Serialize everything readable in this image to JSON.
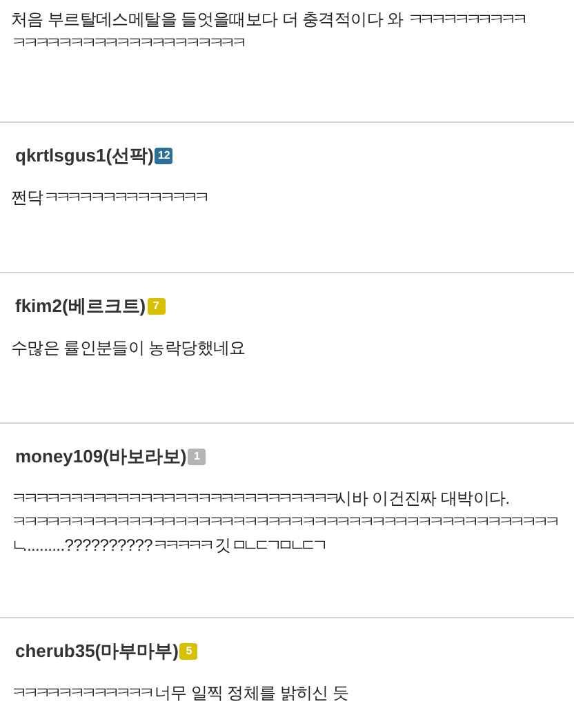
{
  "comments": [
    {
      "body_lines": [
        "처음 부르탈데스메탈을 들엇을때보다 더 충격적이다 와 ㅋㅋㅋㅋㅋㅋㅋㅋㅋㅋ",
        "ㅋㅋㅋㅋㅋㅋㅋㅋㅋㅋㅋㅋㅋㅋㅋㅋㅋㅋㅋㅋ"
      ]
    },
    {
      "author": "qkrtlsgus1(선팍)",
      "level_badge": {
        "text": "12",
        "color": "#2b7099"
      },
      "body_lines": [
        "쩐닥ㅋㅋㅋㅋㅋㅋㅋㅋㅋㅋㅋㅋㅋㅋ"
      ]
    },
    {
      "author": "fkim2(베르크트)",
      "level_badge": {
        "text": "7",
        "color": "#d6c000"
      },
      "body_lines": [
        "수많은 률인분들이 농락당했네요"
      ]
    },
    {
      "author": "money109(바보라보)",
      "level_badge": {
        "text": "1",
        "color": "#b4b4b4"
      },
      "body_lines": [
        "ㅋㅋㅋㅋㅋㅋㅋㅋㅋㅋㅋㅋㅋㅋㅋㅋㅋㅋㅋㅋㅋㅋㅋㅋㅋㅋㅋㅋ시바 이건진짜 대박이다.",
        "ㅋㅋㅋㅋㅋㅋㅋㅋㅋㅋㅋㅋㅋㅋㅋㅋㅋㅋㅋㅋㅋㅋㅋㅋㅋㅋㅋㅋㅋㅋㅋㅋㅋㅋㅋㅋㅋㅋㅋㅋㅋㅋㅋㅋㅋㅋㅋ",
        "ㄴ..........??????????ㅋㅋㅋㅋㅋ 깃ㅁㄴㄷㄱㅁㄴㄷㄱ"
      ]
    },
    {
      "author": "cherub35(마부마부)",
      "level_badge": {
        "text": "5",
        "color": "#d6c000"
      },
      "body_lines": [
        "ㅋㅋㅋㅋㅋㅋㅋㅋㅋㅋㅋㅋ 너무 일찍 정체를 밝히신 듯"
      ]
    }
  ]
}
